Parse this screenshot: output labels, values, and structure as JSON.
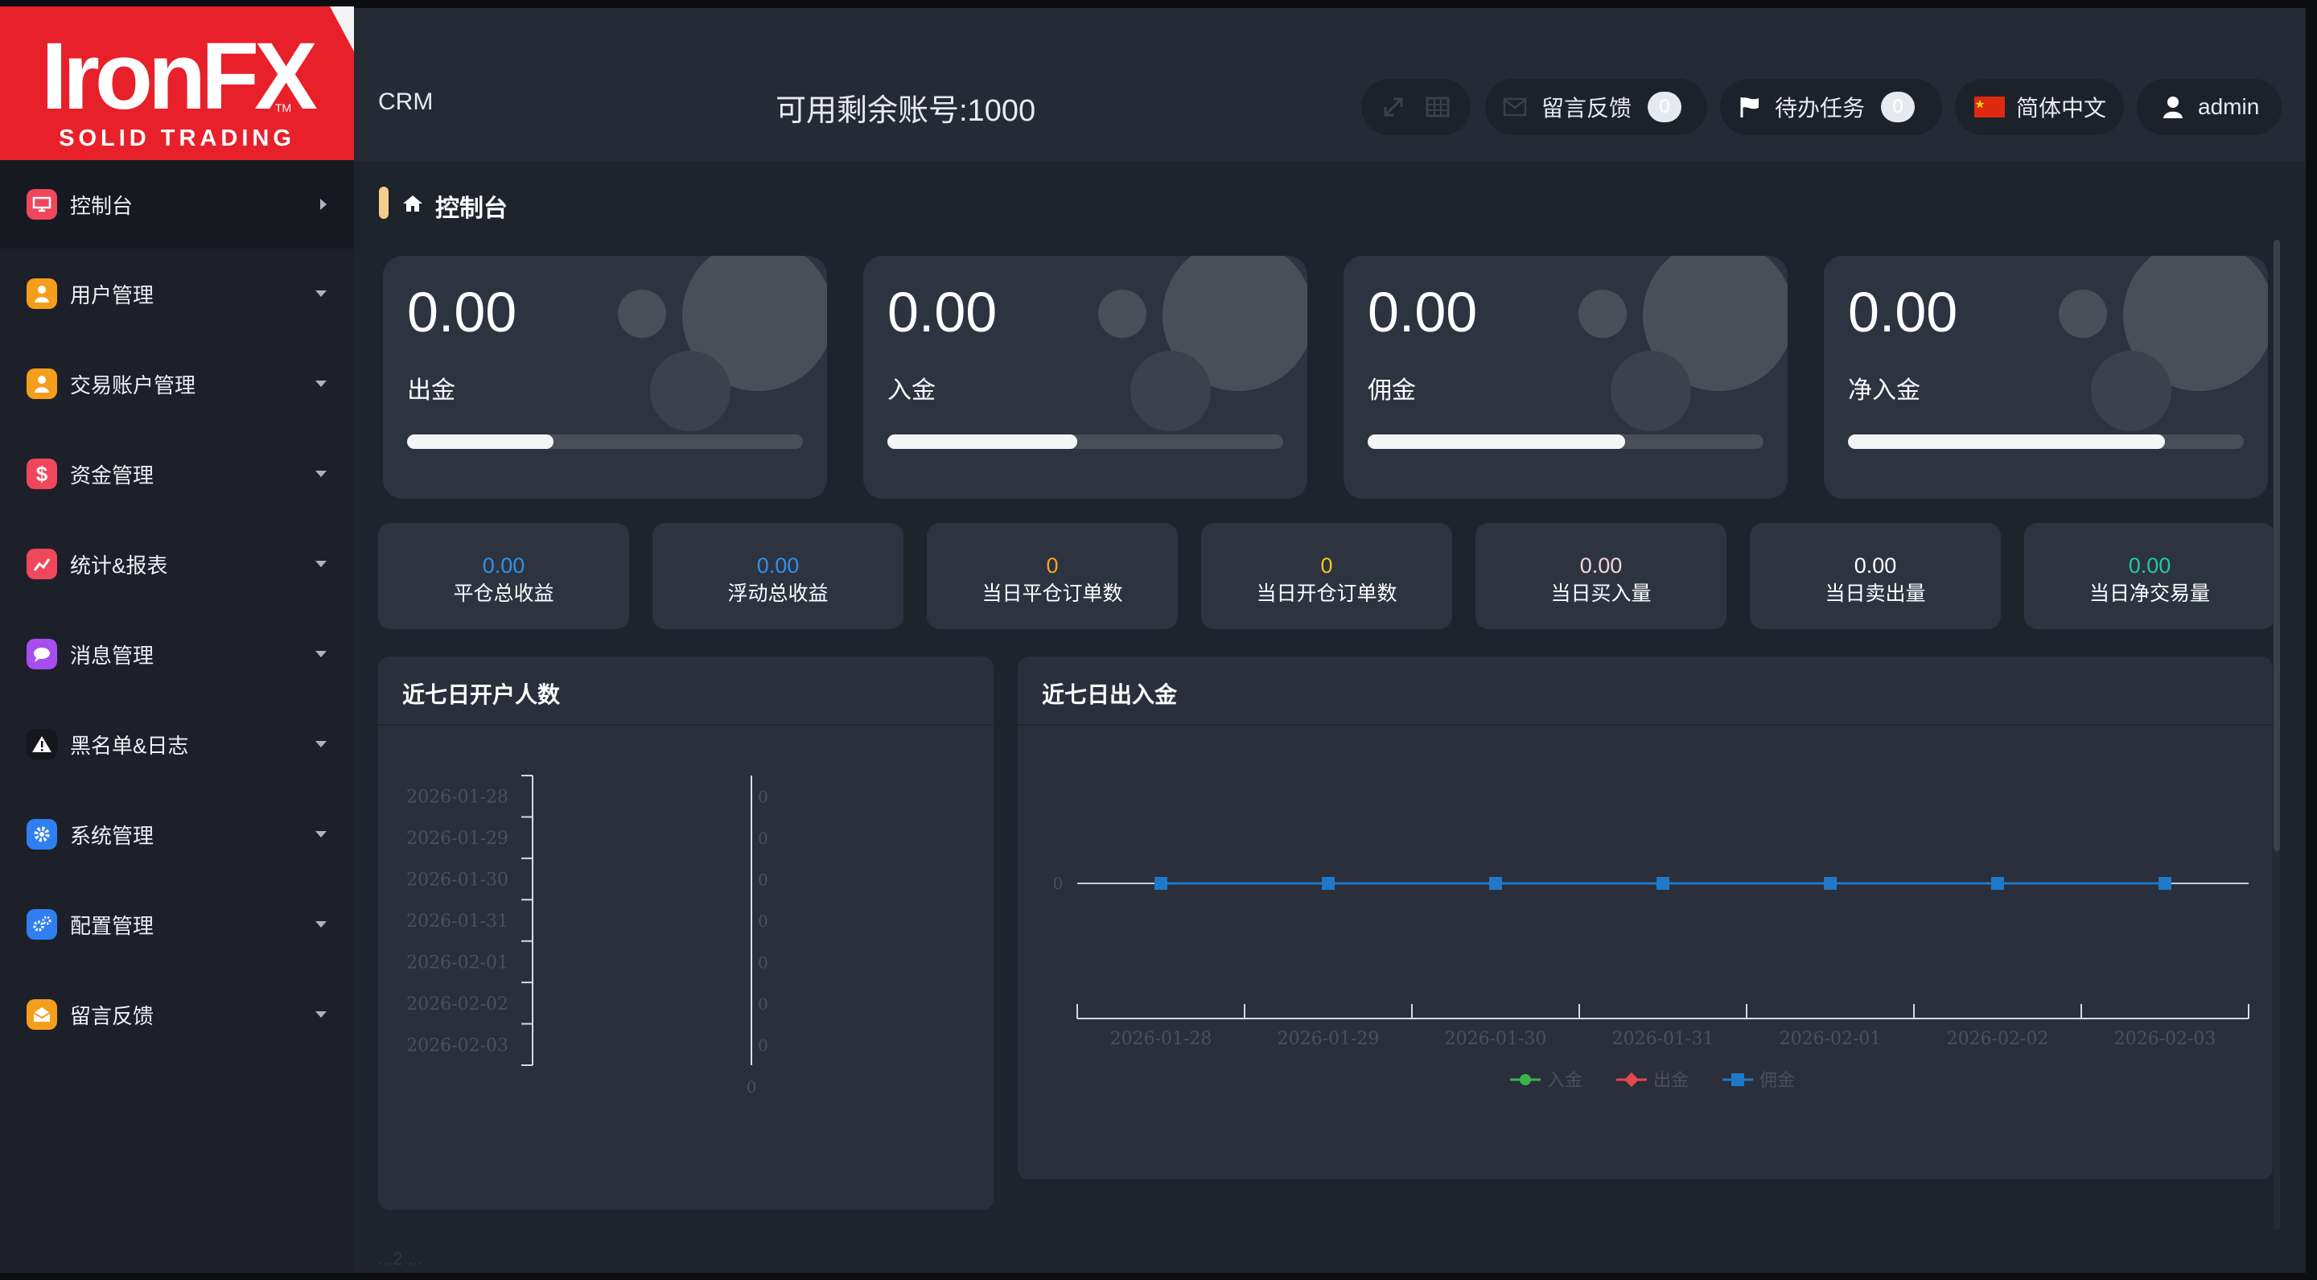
{
  "header": {
    "logo_brand": "IronFX",
    "logo_tagline": "SOLID TRADING",
    "logo_tm": "TM",
    "crm": "CRM",
    "available_accounts": "可用剩余账号:1000",
    "feedback_label": "留言反馈",
    "feedback_count": "0",
    "tasks_label": "待办任务",
    "tasks_count": "0",
    "language": "简体中文",
    "user": "admin"
  },
  "sidebar": {
    "items": [
      {
        "label": "控制台",
        "icon": "monitor-icon",
        "color": "#f0475c"
      },
      {
        "label": "用户管理",
        "icon": "user-icon",
        "color": "#f59e1b"
      },
      {
        "label": "交易账户管理",
        "icon": "user-icon",
        "color": "#f59e1b"
      },
      {
        "label": "资金管理",
        "icon": "dollar-icon",
        "color": "#f0475c"
      },
      {
        "label": "统计&报表",
        "icon": "chart-icon",
        "color": "#f0475c"
      },
      {
        "label": "消息管理",
        "icon": "chat-icon",
        "color": "#a84ef0"
      },
      {
        "label": "黑名单&日志",
        "icon": "warning-icon",
        "color": "#15171c"
      },
      {
        "label": "系统管理",
        "icon": "gear-icon",
        "color": "#2f7ff0"
      },
      {
        "label": "配置管理",
        "icon": "gears-icon",
        "color": "#2f7ff0"
      },
      {
        "label": "留言反馈",
        "icon": "mail-icon",
        "color": "#f59e1b"
      }
    ]
  },
  "breadcrumb": {
    "label": "控制台"
  },
  "cards": [
    {
      "value": "0.00",
      "label": "出金",
      "progress": 0.37
    },
    {
      "value": "0.00",
      "label": "入金",
      "progress": 0.48
    },
    {
      "value": "0.00",
      "label": "佣金",
      "progress": 0.65
    },
    {
      "value": "0.00",
      "label": "净入金",
      "progress": 0.8
    }
  ],
  "stats": [
    {
      "value": "0.00",
      "label": "平仓总收益",
      "color": "#2f8fe8"
    },
    {
      "value": "0.00",
      "label": "浮动总收益",
      "color": "#2f8fe8"
    },
    {
      "value": "0",
      "label": "当日平仓订单数",
      "color": "#f5a623"
    },
    {
      "value": "0",
      "label": "当日开仓订单数",
      "color": "#f5c518"
    },
    {
      "value": "0.00",
      "label": "当日买入量",
      "color": "#f3d8d8"
    },
    {
      "value": "0.00",
      "label": "当日卖出量",
      "color": "#ffffff"
    },
    {
      "value": "0.00",
      "label": "当日净交易量",
      "color": "#1fc9a4"
    }
  ],
  "chart_data": [
    {
      "type": "bar",
      "title": "近七日开户人数",
      "orientation": "horizontal",
      "categories": [
        "2026-01-28",
        "2026-01-29",
        "2026-01-30",
        "2026-01-31",
        "2026-02-01",
        "2026-02-02",
        "2026-02-03"
      ],
      "values": [
        0,
        0,
        0,
        0,
        0,
        0,
        0
      ],
      "x_tick": "0"
    },
    {
      "type": "line",
      "title": "近七日出入金",
      "categories": [
        "2026-01-28",
        "2026-01-29",
        "2026-01-30",
        "2026-01-31",
        "2026-02-01",
        "2026-02-02",
        "2026-02-03"
      ],
      "y_tick": "0",
      "series": [
        {
          "name": "入金",
          "color": "#3cb34a",
          "values": [
            0,
            0,
            0,
            0,
            0,
            0,
            0
          ]
        },
        {
          "name": "出金",
          "color": "#e5484d",
          "values": [
            0,
            0,
            0,
            0,
            0,
            0,
            0
          ]
        },
        {
          "name": "佣金",
          "color": "#1f78c8",
          "values": [
            0,
            0,
            0,
            0,
            0,
            0,
            0
          ]
        }
      ],
      "legend": "bottom-center"
    }
  ],
  "footer": {
    "faded_text": "...2 ..."
  }
}
